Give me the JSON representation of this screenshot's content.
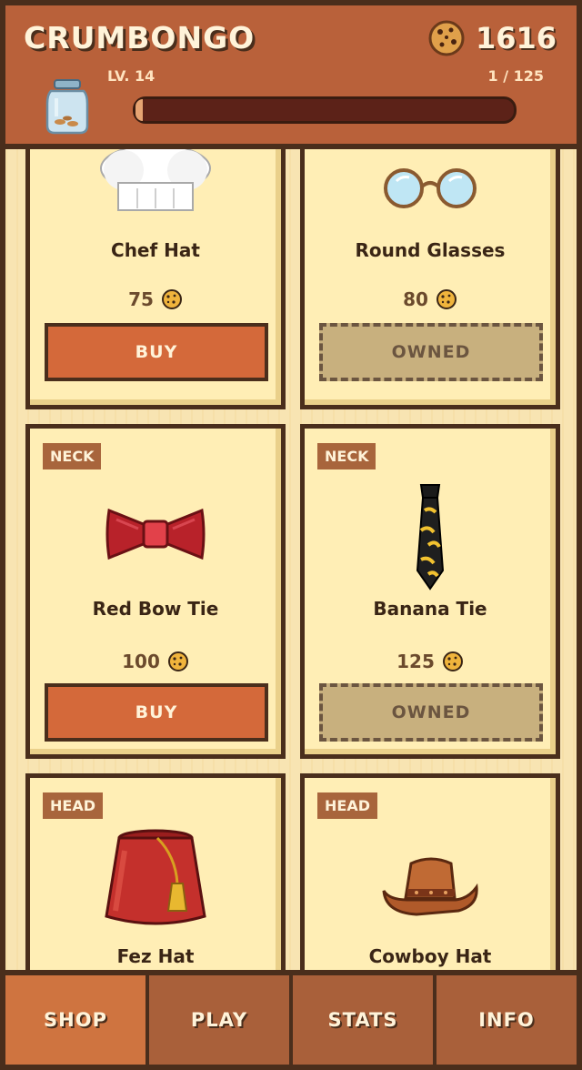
{
  "header": {
    "title": "CRUMBONGO",
    "cookies": "1616",
    "level": "LV. 14",
    "progress_label": "1 / 125",
    "progress_fraction": 0.008,
    "icons": [
      "cookie-icon",
      "cookie-jar-icon"
    ]
  },
  "shop": {
    "items": [
      {
        "name": "Chef Hat",
        "price": "75",
        "button": "BUY",
        "state": "buy",
        "icon": "chef-hat-icon"
      },
      {
        "name": "Round Glasses",
        "price": "80",
        "button": "OWNED",
        "state": "owned",
        "icon": "round-glasses-icon"
      },
      {
        "category": "NECK",
        "name": "Red Bow Tie",
        "price": "100",
        "button": "BUY",
        "state": "buy",
        "icon": "red-bow-tie-icon"
      },
      {
        "category": "NECK",
        "name": "Banana Tie",
        "price": "125",
        "button": "OWNED",
        "state": "owned",
        "icon": "banana-tie-icon"
      },
      {
        "category": "HEAD",
        "name": "Fez Hat",
        "icon": "fez-hat-icon"
      },
      {
        "category": "HEAD",
        "name": "Cowboy Hat",
        "icon": "cowboy-hat-icon"
      }
    ]
  },
  "nav": {
    "tabs": [
      "SHOP",
      "PLAY",
      "STATS",
      "INFO"
    ],
    "active": "SHOP"
  },
  "colors": {
    "header": "#b9613a",
    "border": "#4a2e1c",
    "card": "#ffeeb5",
    "buy_button": "#d4693a",
    "owned_button": "#c8b07e"
  }
}
